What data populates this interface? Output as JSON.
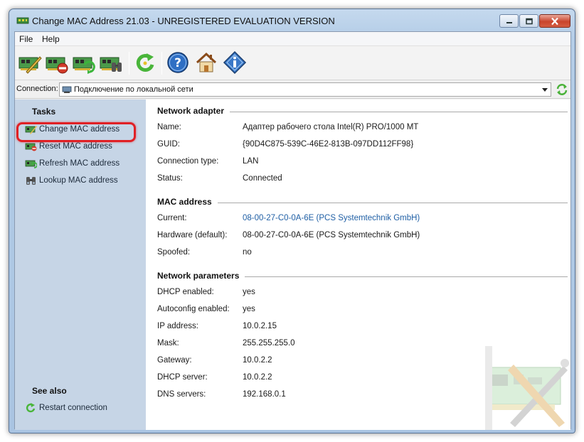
{
  "window": {
    "title": "Change MAC Address 21.03 - UNREGISTERED EVALUATION VERSION"
  },
  "menu": {
    "items": [
      "File",
      "Help"
    ]
  },
  "toolbar": {
    "buttons": [
      "change-mac-icon",
      "reset-mac-icon",
      "refresh-mac-icon",
      "lookup-mac-icon",
      "restart-connection-icon",
      "help-icon",
      "home-icon",
      "info-icon"
    ]
  },
  "connection": {
    "label": "Connection:",
    "value": "Подключение по локальной сети"
  },
  "tasks": {
    "heading": "Tasks",
    "items": [
      {
        "label": "Change MAC address",
        "icon": "change-mac-icon"
      },
      {
        "label": "Reset MAC address",
        "icon": "reset-mac-icon"
      },
      {
        "label": "Refresh MAC address",
        "icon": "refresh-mac-icon"
      },
      {
        "label": "Lookup MAC address",
        "icon": "binoculars-icon"
      }
    ]
  },
  "see_also": {
    "heading": "See also",
    "items": [
      {
        "label": "Restart connection",
        "icon": "restart-icon"
      }
    ]
  },
  "network_adapter": {
    "heading": "Network adapter",
    "rows": [
      {
        "label": "Name:",
        "value": "Адаптер рабочего стола Intel(R) PRO/1000 MT"
      },
      {
        "label": "GUID:",
        "value": "{90D4C875-539C-46E2-813B-097DD112FF98}"
      },
      {
        "label": "Connection type:",
        "value": "LAN"
      },
      {
        "label": "Status:",
        "value": "Connected"
      }
    ]
  },
  "mac_address": {
    "heading": "MAC address",
    "rows": [
      {
        "label": "Current:",
        "value": "08-00-27-C0-0A-6E (PCS Systemtechnik GmbH)"
      },
      {
        "label": "Hardware (default):",
        "value": "08-00-27-C0-0A-6E (PCS Systemtechnik GmbH)"
      },
      {
        "label": "Spoofed:",
        "value": "no"
      }
    ]
  },
  "network_parameters": {
    "heading": "Network parameters",
    "rows": [
      {
        "label": "DHCP enabled:",
        "value": "yes"
      },
      {
        "label": "Autoconfig enabled:",
        "value": "yes"
      },
      {
        "label": "IP address:",
        "value": "10.0.2.15"
      },
      {
        "label": "Mask:",
        "value": "255.255.255.0"
      },
      {
        "label": "Gateway:",
        "value": "10.0.2.2"
      },
      {
        "label": "DHCP server:",
        "value": "10.0.2.2"
      },
      {
        "label": "DNS servers:",
        "value": "192.168.0.1"
      }
    ]
  },
  "colors": {
    "sidebar_bg": "#c6d5e6",
    "link": "#1f5fa5",
    "highlight": "#e02025"
  }
}
